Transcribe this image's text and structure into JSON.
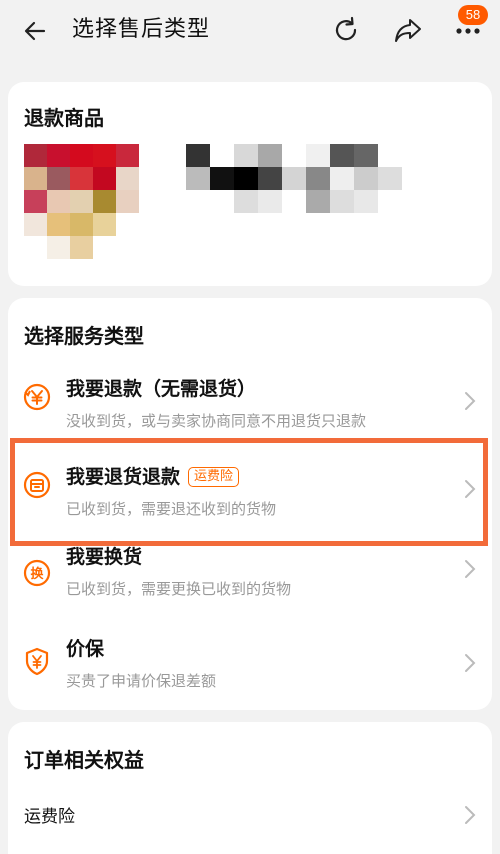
{
  "header": {
    "title": "选择售后类型",
    "badge_count": "58"
  },
  "products": {
    "title": "退款商品"
  },
  "services": {
    "title": "选择服务类型",
    "options": [
      {
        "title": "我要退款（无需退货）",
        "desc": "没收到货，或与卖家协商同意不用退货只退款",
        "icon": "yen-refund-icon"
      },
      {
        "title": "我要退货退款",
        "tag": "运费险",
        "desc": "已收到货，需要退还收到的货物",
        "icon": "return-box-icon"
      },
      {
        "title": "我要换货",
        "desc": "已收到货，需要更换已收到的货物",
        "icon": "exchange-icon"
      },
      {
        "title": "价保",
        "desc": "买贵了申请价保退差额",
        "icon": "price-shield-icon"
      }
    ]
  },
  "rights": {
    "title": "订单相关权益",
    "items": [
      {
        "label": "运费险"
      }
    ]
  },
  "colors": {
    "accent": "#ff6a00",
    "highlight": "#f26b3a",
    "background": "#f2f2f2"
  }
}
